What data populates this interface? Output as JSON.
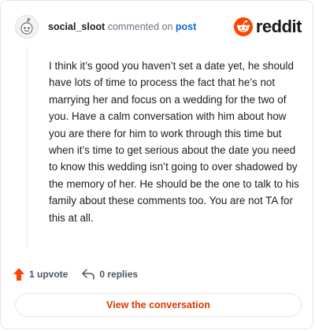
{
  "header": {
    "username": "social_sloot",
    "action_text": "commented on",
    "post_link": "post",
    "brand_name": "reddit",
    "avatar_icon": "snoo-avatar-icon",
    "brand_icon": "reddit-logo-icon",
    "brand_color": "#ff4500"
  },
  "comment": {
    "body": "I think it’s good you haven’t set a date yet, he should have lots of time to process the fact that he’s not marrying her and focus on a wedding for the two of you. Have a calm conversation with him about how you are there for him to work through this time but when it’s time to get serious about the date you need to know this wedding isn’t going to over shadowed by the memory of her. He should be the one to talk to his family about these comments too. You are not TA for this at all."
  },
  "actions": {
    "upvote_label": "1 upvote",
    "upvote_icon": "upvote-arrow-icon",
    "replies_label": "0 replies",
    "reply_icon": "reply-arrow-icon",
    "upvote_color": "#ff4500"
  },
  "footer": {
    "view_label": "View the conversation",
    "link_color": "#d93a00"
  }
}
